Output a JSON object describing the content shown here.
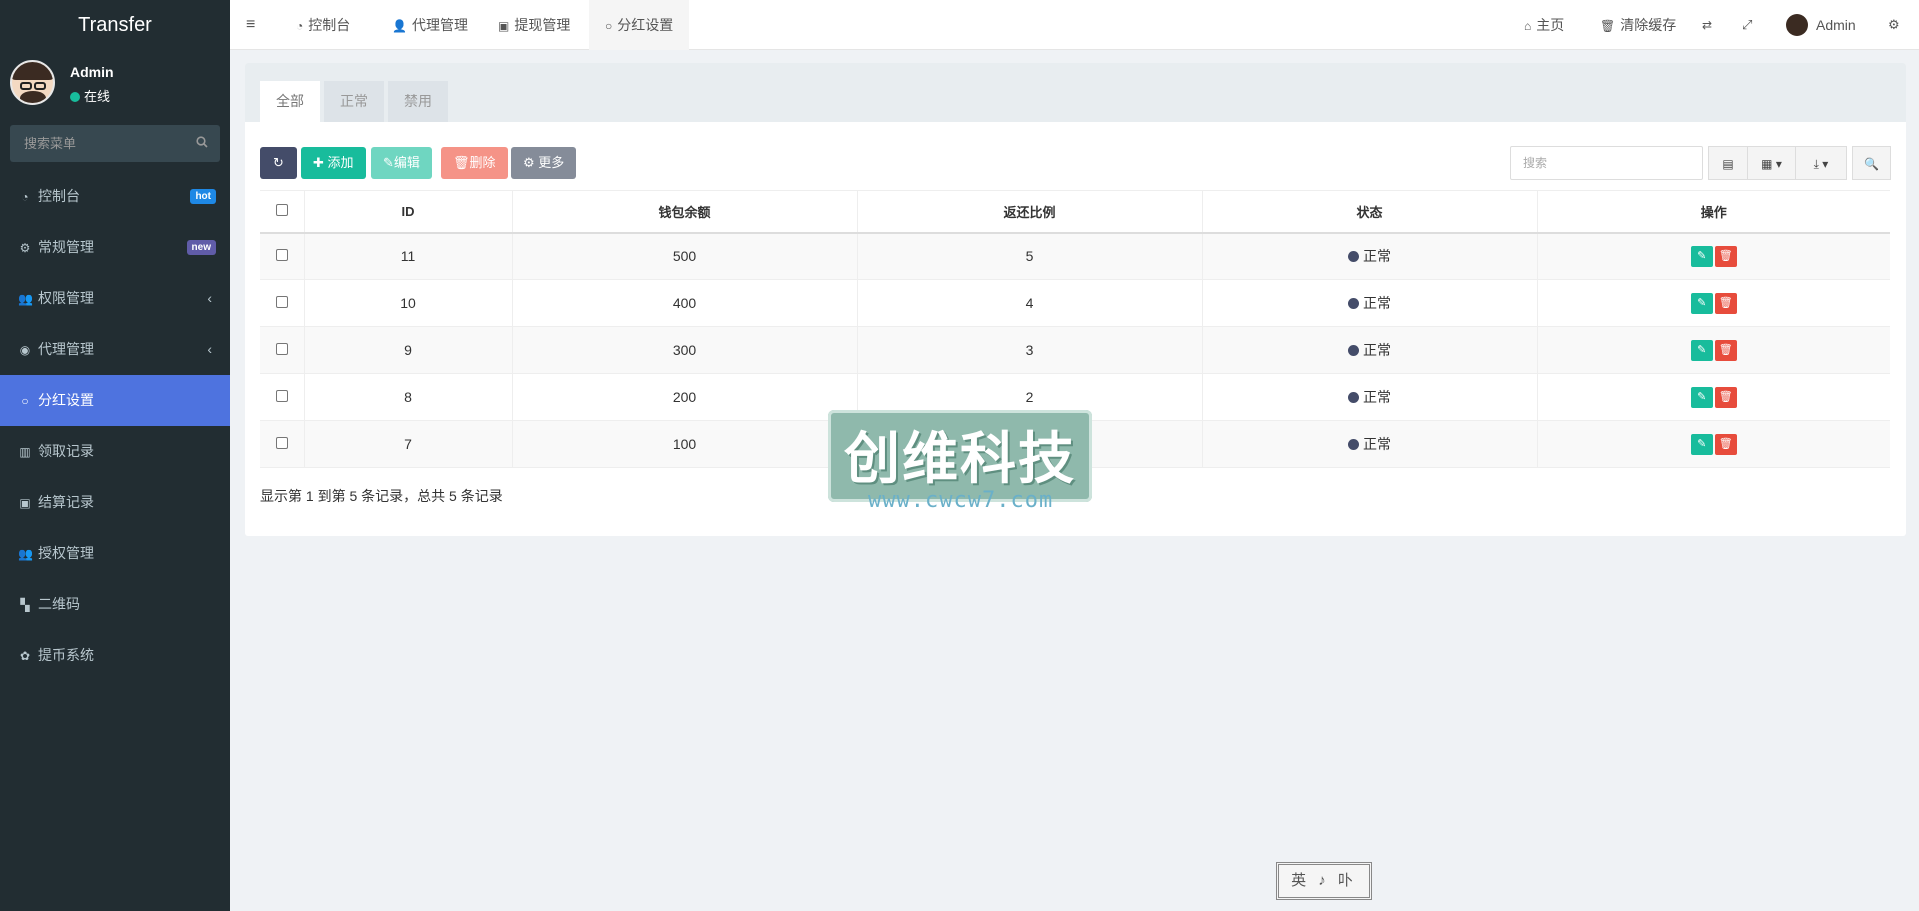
{
  "sidebar": {
    "logo": "Transfer",
    "user": {
      "name": "Admin",
      "status": "在线"
    },
    "search_placeholder": "搜索菜单",
    "items": [
      {
        "label": "控制台",
        "icon": "dashboard-icon",
        "badge": "hot"
      },
      {
        "label": "常规管理",
        "icon": "cogs-icon",
        "badge": "new"
      },
      {
        "label": "权限管理",
        "icon": "users-icon",
        "chevron": "‹"
      },
      {
        "label": "代理管理",
        "icon": "user-circle-icon",
        "chevron": "‹"
      },
      {
        "label": "分红设置",
        "icon": "circle-icon",
        "active": true
      },
      {
        "label": "领取记录",
        "icon": "bar-chart-icon"
      },
      {
        "label": "结算记录",
        "icon": "cc-icon"
      },
      {
        "label": "授权管理",
        "icon": "users-icon"
      },
      {
        "label": "二维码",
        "icon": "qrcode-icon"
      },
      {
        "label": "提币系统",
        "icon": "gear-icon"
      }
    ]
  },
  "navbar": {
    "tabs": [
      {
        "label": "控制台",
        "icon": "dashboard-icon"
      },
      {
        "label": "代理管理",
        "icon": "user-icon"
      },
      {
        "label": "提现管理",
        "icon": "cc-icon"
      },
      {
        "label": "分红设置",
        "icon": "circle-icon",
        "active": true
      }
    ],
    "right": {
      "home": "主页",
      "clear_cache": "清除缓存",
      "admin": "Admin"
    }
  },
  "page": {
    "tabs": [
      "全部",
      "正常",
      "禁用"
    ],
    "active_tab": "全部",
    "toolbar": {
      "add": "添加",
      "edit": "编辑",
      "delete": "删除",
      "more": "更多"
    },
    "search_placeholder": "搜索",
    "table": {
      "columns": [
        "ID",
        "钱包余额",
        "返还比例",
        "状态",
        "操作"
      ],
      "rows": [
        {
          "id": "11",
          "balance": "500",
          "ratio": "5",
          "status": "正常"
        },
        {
          "id": "10",
          "balance": "400",
          "ratio": "4",
          "status": "正常"
        },
        {
          "id": "9",
          "balance": "300",
          "ratio": "3",
          "status": "正常"
        },
        {
          "id": "8",
          "balance": "200",
          "ratio": "2",
          "status": "正常"
        },
        {
          "id": "7",
          "balance": "100",
          "ratio": "1",
          "status": "正常"
        }
      ]
    },
    "pagination_text": "显示第 1 到第 5 条记录，总共 5 条记录"
  },
  "watermark": {
    "title": "创维科技",
    "url": "www.cwcw7.com"
  },
  "stamp": "英 ♪ 卟",
  "colors": {
    "sidebar_bg": "#222d32",
    "active_menu": "#4e73df",
    "success": "#18bc9c",
    "danger": "#e74c3c",
    "primary_dark": "#444c69"
  }
}
